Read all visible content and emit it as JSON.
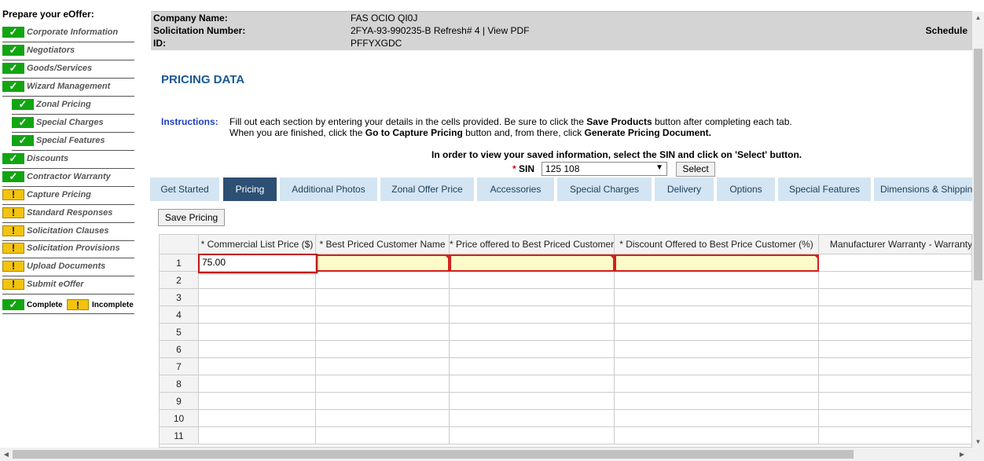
{
  "sidebar": {
    "title": "Prepare your eOffer:",
    "items": [
      {
        "label": "Corporate Information",
        "status": "complete"
      },
      {
        "label": "Negotiators",
        "status": "complete"
      },
      {
        "label": "Goods/Services",
        "status": "complete"
      },
      {
        "label": "Wizard Management",
        "status": "complete"
      },
      {
        "label": "Zonal Pricing",
        "status": "complete"
      },
      {
        "label": "Special Charges",
        "status": "complete"
      },
      {
        "label": "Special Features",
        "status": "complete"
      },
      {
        "label": "Discounts",
        "status": "complete"
      },
      {
        "label": "Contractor Warranty",
        "status": "complete"
      },
      {
        "label": "Capture Pricing",
        "status": "incomplete"
      },
      {
        "label": "Standard Responses",
        "status": "incomplete"
      },
      {
        "label": "Solicitation Clauses",
        "status": "incomplete"
      },
      {
        "label": "Solicitation Provisions",
        "status": "incomplete"
      },
      {
        "label": "Upload Documents",
        "status": "incomplete"
      },
      {
        "label": "Submit eOffer",
        "status": "incomplete"
      }
    ],
    "legend": {
      "complete": "Complete",
      "incomplete": "Incomplete"
    }
  },
  "header": {
    "company_label": "Company Name:",
    "company_value": "FAS OCIO QI0J",
    "solicitation_label": "Solicitation Number:",
    "solicitation_value": "2FYA-93-990235-B Refresh# 4 |",
    "view_pdf": "View PDF",
    "id_label": "ID:",
    "id_value": "PFFYXGDC",
    "schedule": "Schedule"
  },
  "page": {
    "title": "PRICING DATA",
    "instructions_label": "Instructions:",
    "instructions_line1_pre": "Fill out each section by entering your details in the cells provided. Be sure to click the ",
    "instructions_line1_bold": "Save Products",
    "instructions_line1_post": " button after completing each tab.",
    "instructions_line2_pre": "When you are finished, click the ",
    "instructions_line2_bold1": "Go to Capture Pricing",
    "instructions_line2_mid": " button and, from there, click ",
    "instructions_line2_bold2": "Generate Pricing Document.",
    "sin_note": "In order to view your saved information, select the SIN and click on 'Select' button.",
    "sin_required": "*",
    "sin_label": "SIN",
    "sin_value": "125 108",
    "select_button": "Select",
    "save_pricing": "Save Pricing"
  },
  "tabs": [
    {
      "label": "Get Started",
      "active": false
    },
    {
      "label": "Pricing",
      "active": true
    },
    {
      "label": "Additional Photos",
      "active": false
    },
    {
      "label": "Zonal Offer Price",
      "active": false
    },
    {
      "label": "Accessories",
      "active": false
    },
    {
      "label": "Special Charges",
      "active": false
    },
    {
      "label": "Delivery",
      "active": false
    },
    {
      "label": "Options",
      "active": false
    },
    {
      "label": "Special Features",
      "active": false
    },
    {
      "label": "Dimensions & Shipping",
      "active": false
    }
  ],
  "grid": {
    "columns": [
      "* Commercial List Price ($)",
      "* Best Priced Customer Name",
      "* Price offered to Best Priced Customer",
      "* Discount Offered to Best Price Customer (%)",
      "Manufacturer Warranty - Warranty"
    ],
    "rows": [
      "1",
      "2",
      "3",
      "4",
      "5",
      "6",
      "7",
      "8",
      "9",
      "10",
      "11"
    ],
    "row1_values": [
      "75.00",
      "",
      "",
      "",
      ""
    ]
  },
  "colors": {
    "active_tab": "#2c4f73",
    "tab": "#d3e5f2",
    "title": "#1a5a94",
    "complete": "#12a512",
    "incomplete": "#f2c30f",
    "required_cell": "#fbfac8"
  }
}
